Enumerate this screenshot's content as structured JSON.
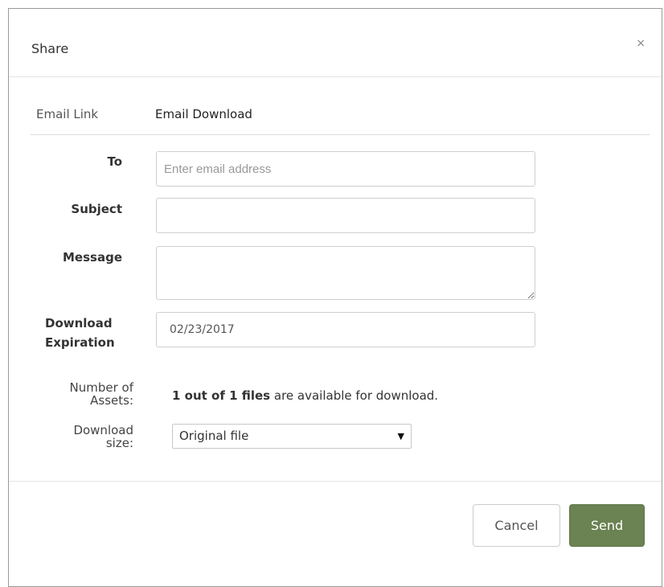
{
  "dialog": {
    "title": "Share",
    "close_glyph": "×"
  },
  "tabs": [
    {
      "label": "Email Link",
      "active": false
    },
    {
      "label": "Email Download",
      "active": true
    }
  ],
  "form": {
    "to_label": "To",
    "to_placeholder": "Enter email address",
    "to_value": "",
    "subject_label": "Subject",
    "subject_value": "",
    "message_label": "Message",
    "message_value": "",
    "expiration_label_line1": "Download",
    "expiration_label_line2": "Expiration",
    "expiration_value": "02/23/2017"
  },
  "assets": {
    "count_label_line1": "Number of",
    "count_label_line2": "Assets:",
    "count_bold": "1 out of 1 files",
    "count_rest": " are available for download.",
    "size_label_line1": "Download",
    "size_label_line2": "size:",
    "size_selected": "Original file",
    "size_arrow": "▼"
  },
  "footer": {
    "cancel_label": "Cancel",
    "send_label": "Send"
  },
  "colors": {
    "send_button": "#6b8252",
    "border": "#cfcfcf"
  }
}
